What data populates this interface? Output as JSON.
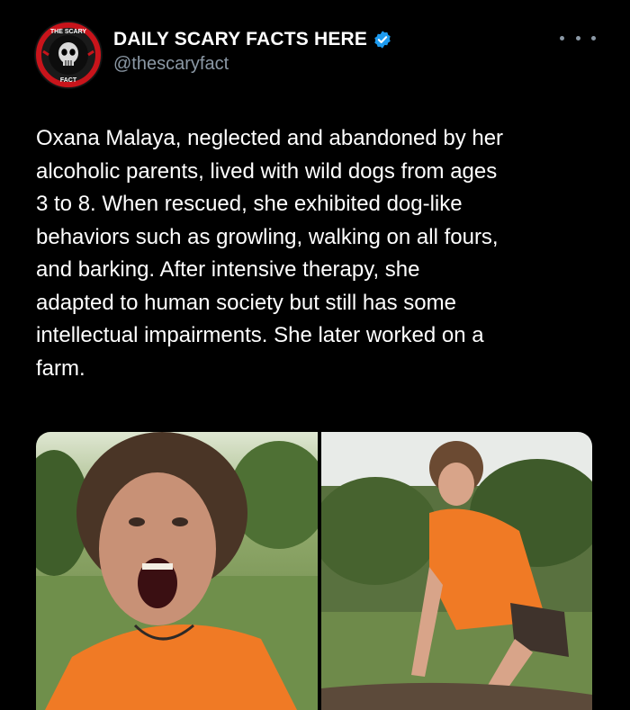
{
  "tweet": {
    "author_name": "DAILY SCARY FACTS HERE",
    "author_handle": "@thescaryfact",
    "text": "Oxana Malaya, neglected and abandoned by her\nalcoholic parents, lived with wild dogs from ages\n3 to 8. When rescued, she exhibited dog-like\nbehaviors such as growling, walking on all fours,\nand barking. After intensive therapy, she\nadapted to human society but still has some\nintellectual impairments. She later worked on a\nfarm.",
    "verified_badge": "verified-badge-icon",
    "more_icon": "more-options-icon",
    "avatar_logo_text": [
      "THE SCARY",
      "FACT"
    ]
  },
  "colors": {
    "background": "#000000",
    "text": "#ffffff",
    "secondary_text": "#8b98a5",
    "verified": "#1d9bf0",
    "avatar_red": "#c8141b"
  }
}
